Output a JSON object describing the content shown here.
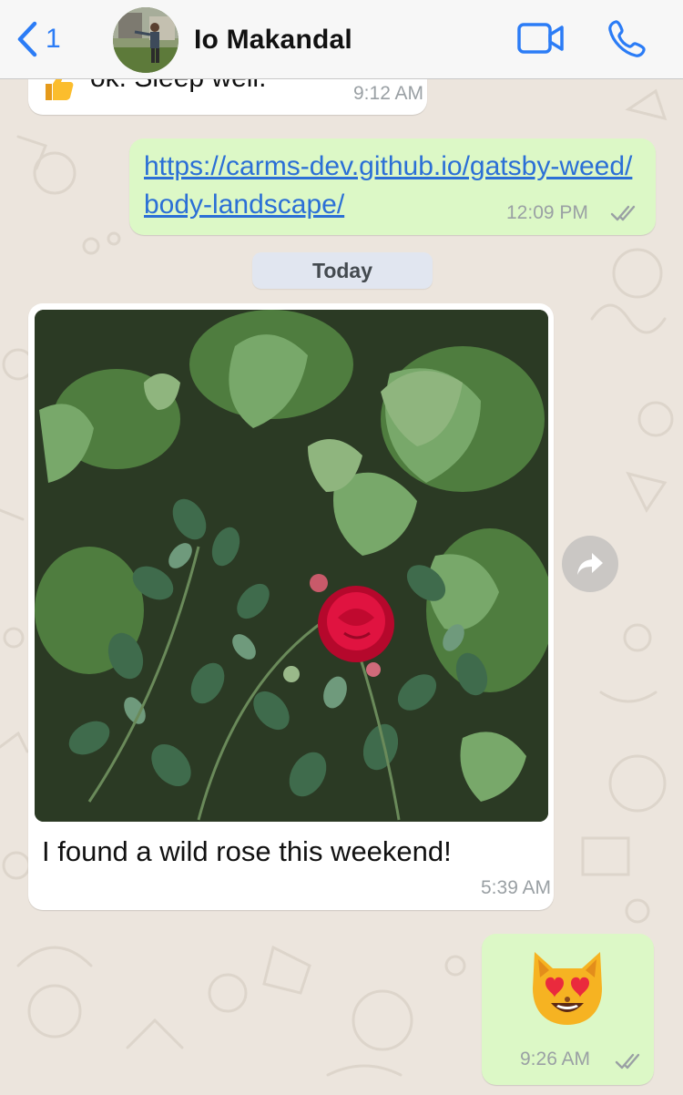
{
  "header": {
    "back_count": "1",
    "contact_name": "Io Makandal",
    "accent_color": "#2b7cf6"
  },
  "messages": [
    {
      "direction": "incoming",
      "emoji": "thumbs-up",
      "text": "ok. Sleep well.",
      "time": "9:12 AM"
    },
    {
      "direction": "outgoing",
      "text": "https://carms-dev.github.io/gatsby-weed/body-landscape/",
      "time": "12:09 PM",
      "status": "read"
    },
    {
      "direction": "incoming",
      "image": "red rose among green leaves",
      "caption": "I found a wild rose this weekend!",
      "time": "5:39 AM"
    },
    {
      "direction": "outgoing",
      "emoji": "smiling-cat-with-heart-eyes",
      "time": "9:26 AM",
      "status": "read"
    }
  ],
  "date_separator": "Today",
  "colors": {
    "outgoing_bubble": "#dcf8c6",
    "incoming_bubble": "#ffffff",
    "chat_background": "#ece5dd",
    "link": "#2b6fd6"
  }
}
